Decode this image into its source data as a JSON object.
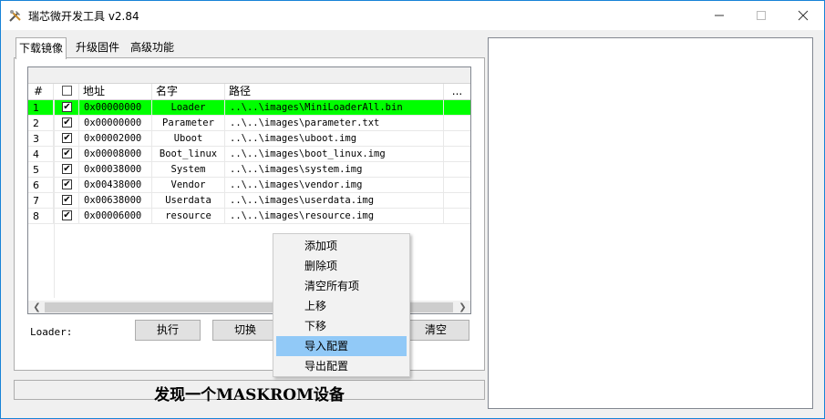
{
  "window": {
    "title": "瑞芯微开发工具 v2.84"
  },
  "tabs": [
    {
      "label": "下载镜像"
    },
    {
      "label": "升级固件"
    },
    {
      "label": "高级功能"
    }
  ],
  "table": {
    "columns": [
      "#",
      "地址",
      "名字",
      "路径",
      "..."
    ],
    "rows": [
      {
        "num": "1",
        "checked": "✔",
        "address": "0x00000000",
        "name": "Loader",
        "path": "..\\..\\images\\MiniLoaderAll.bin"
      },
      {
        "num": "2",
        "checked": "✔",
        "address": "0x00000000",
        "name": "Parameter",
        "path": "..\\..\\images\\parameter.txt"
      },
      {
        "num": "3",
        "checked": "✔",
        "address": "0x00002000",
        "name": "Uboot",
        "path": "..\\..\\images\\uboot.img"
      },
      {
        "num": "4",
        "checked": "✔",
        "address": "0x00008000",
        "name": "Boot_linux",
        "path": "..\\..\\images\\boot_linux.img"
      },
      {
        "num": "5",
        "checked": "✔",
        "address": "0x00038000",
        "name": "System",
        "path": "..\\..\\images\\system.img"
      },
      {
        "num": "6",
        "checked": "✔",
        "address": "0x00438000",
        "name": "Vendor",
        "path": "..\\..\\images\\vendor.img"
      },
      {
        "num": "7",
        "checked": "✔",
        "address": "0x00638000",
        "name": "Userdata",
        "path": "..\\..\\images\\userdata.img"
      },
      {
        "num": "8",
        "checked": "✔",
        "address": "0x00006000",
        "name": "resource",
        "path": "..\\..\\images\\resource.img"
      }
    ],
    "selected_color": "#00ff00"
  },
  "controls": {
    "loader_label": "Loader:",
    "execute_label": "执行",
    "switch_label": "切换",
    "clear_label": "清空"
  },
  "status": {
    "text": "发现一个MASKROM设备"
  },
  "context_menu": {
    "items": [
      "添加项",
      "删除项",
      "清空所有项",
      "上移",
      "下移",
      "导入配置",
      "导出配置"
    ],
    "highlight_color": "#91c9f7"
  },
  "icons": {
    "minimize": "minimize-icon",
    "maximize": "maximize-icon",
    "close": "close-icon"
  }
}
